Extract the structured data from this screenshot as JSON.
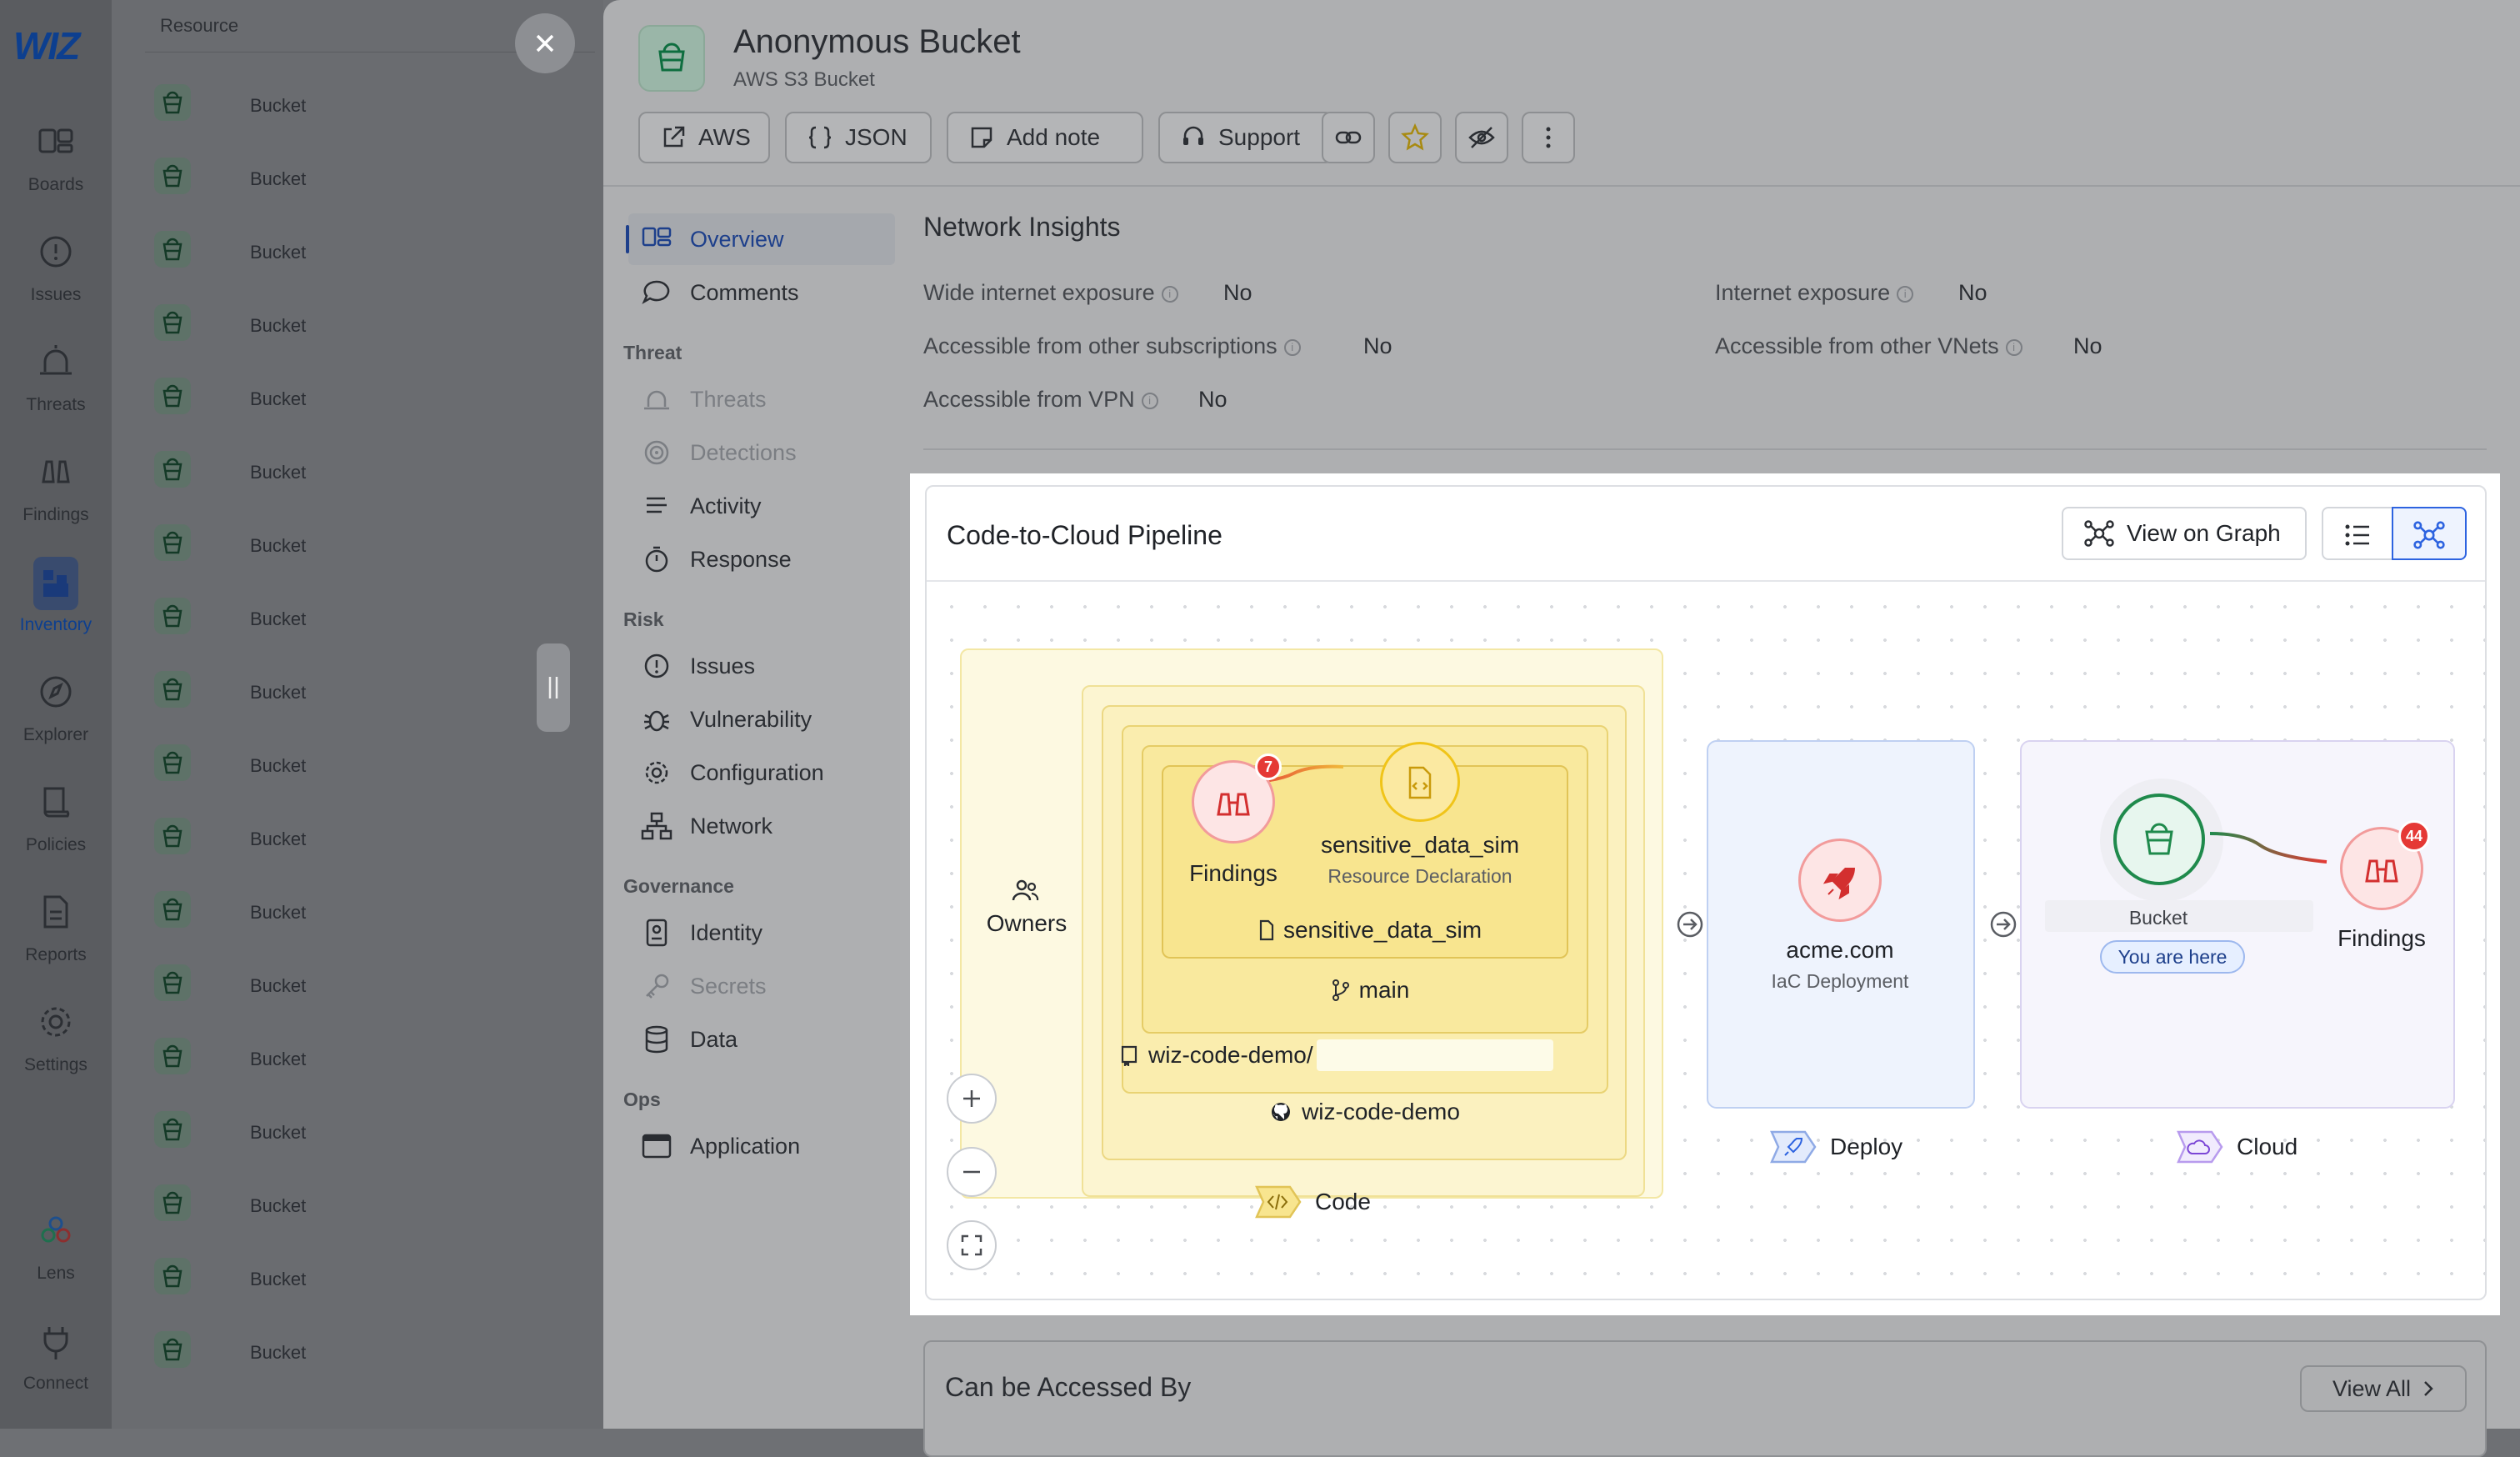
{
  "app": {
    "logo": "WIZ"
  },
  "leftnav": {
    "items": [
      {
        "label": "Boards",
        "icon": "boards-icon"
      },
      {
        "label": "Issues",
        "icon": "issues-icon"
      },
      {
        "label": "Threats",
        "icon": "threats-icon"
      },
      {
        "label": "Findings",
        "icon": "findings-icon"
      },
      {
        "label": "Inventory",
        "icon": "inventory-icon",
        "active": true
      },
      {
        "label": "Explorer",
        "icon": "explorer-icon"
      },
      {
        "label": "Policies",
        "icon": "policies-icon"
      },
      {
        "label": "Reports",
        "icon": "reports-icon"
      },
      {
        "label": "Settings",
        "icon": "settings-icon"
      },
      {
        "label": "Lens",
        "icon": "lens-icon"
      },
      {
        "label": "Connect",
        "icon": "connect-icon"
      }
    ]
  },
  "resource_list": {
    "header": "Resource",
    "rows": [
      "Bucket",
      "Bucket",
      "Bucket",
      "Bucket",
      "Bucket",
      "Bucket",
      "Bucket",
      "Bucket",
      "Bucket",
      "Bucket",
      "Bucket",
      "Bucket",
      "Bucket",
      "Bucket",
      "Bucket",
      "Bucket",
      "Bucket",
      "Bucket"
    ]
  },
  "drawer": {
    "title": "Anonymous Bucket",
    "subtitle": "AWS S3 Bucket",
    "toolbar": {
      "aws": "AWS",
      "json": "JSON",
      "add_note": "Add note",
      "support": "Support"
    },
    "menu": {
      "overview": "Overview",
      "comments": "Comments",
      "group_threat": "Threat",
      "threats": "Threats",
      "detections": "Detections",
      "activity": "Activity",
      "response": "Response",
      "group_risk": "Risk",
      "issues": "Issues",
      "vulnerability": "Vulnerability",
      "configuration": "Configuration",
      "network": "Network",
      "group_governance": "Governance",
      "identity": "Identity",
      "secrets": "Secrets",
      "data": "Data",
      "group_ops": "Ops",
      "application": "Application"
    },
    "network_insights": {
      "title": "Network Insights",
      "rows": [
        {
          "label": "Wide internet exposure",
          "value": "No"
        },
        {
          "label": "Accessible from other subscriptions",
          "value": "No"
        },
        {
          "label": "Accessible from VPN",
          "value": "No"
        },
        {
          "label": "Internet exposure",
          "value": "No"
        },
        {
          "label": "Accessible from other VNets",
          "value": "No"
        }
      ]
    },
    "pipeline": {
      "title": "Code-to-Cloud Pipeline",
      "view_on_graph": "View on Graph",
      "code": {
        "owners": "Owners",
        "findings_label": "Findings",
        "findings_count": "7",
        "file_node": "sensitive_data_sim",
        "file_sub": "Resource Declaration",
        "file_name": "sensitive_data_sim",
        "branch": "main",
        "repo_path": "wiz-code-demo/",
        "repo": "wiz-code-demo",
        "stage": "Code"
      },
      "deploy": {
        "label": "acme.com",
        "sub": "IaC Deployment",
        "stage": "Deploy"
      },
      "cloud": {
        "bucket_label": "Bucket",
        "you_are_here": "You are here",
        "findings_label": "Findings",
        "findings_count": "44",
        "stage": "Cloud"
      }
    },
    "accessed_by": {
      "title": "Can be Accessed By",
      "view_all": "View All"
    }
  }
}
